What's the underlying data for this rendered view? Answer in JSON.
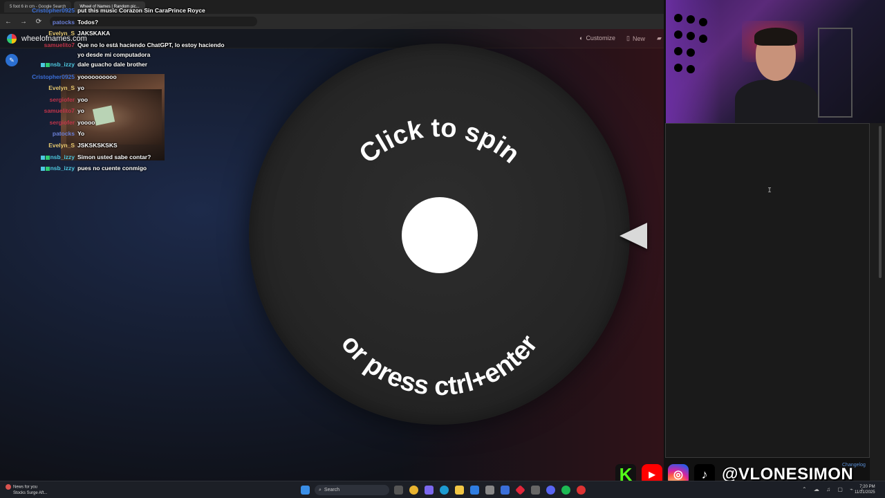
{
  "browser": {
    "tabs": [
      {
        "label": "5 foot 6 in cm - Google Search",
        "active": false
      },
      {
        "label": "Wheel of Names | Random pic...",
        "active": true
      }
    ],
    "nav": {
      "back": "←",
      "forward": "→",
      "reload": "⟳"
    }
  },
  "site": {
    "name": "wheelofnames.com",
    "menu": {
      "customize": "Customize",
      "new": "New"
    },
    "wheel": {
      "top_text": "Click to spin",
      "bottom_text": "or press ctrl+enter"
    }
  },
  "chat": {
    "messages": [
      {
        "user": "Cristopher0925",
        "text": "put this music Corazon Sin CaraPrince Royce",
        "color": "#3b6fd8",
        "badge": false
      },
      {
        "user": "patocks",
        "text": "Todos?",
        "color": "#6a7fd6",
        "badge": false
      },
      {
        "user": "Evelyn_S",
        "text": "JAKSKAKA",
        "color": "#e6c86e",
        "badge": false
      },
      {
        "user": "samuelito7",
        "text": "Que no lo está haciendo ChatGPT, lo estoy haciendo",
        "color": "#c0344a",
        "badge": false
      },
      {
        "user": "",
        "text": "yo desde mi computadora",
        "color": "#c0344a",
        "badge": false
      },
      {
        "user": "nsb_izzy",
        "text": "dale guacho dale brother",
        "color": "#4ec9e0",
        "badge": true
      },
      {
        "user": "Cristopher0925",
        "text": "yoooooooooo",
        "color": "#3b6fd8",
        "badge": false
      },
      {
        "user": "Evelyn_S",
        "text": "yo",
        "color": "#e6c86e",
        "badge": false
      },
      {
        "user": "sergiofer",
        "text": "yoo",
        "color": "#c0344a",
        "badge": false
      },
      {
        "user": "samuelito7",
        "text": "yo",
        "color": "#c0344a",
        "badge": false
      },
      {
        "user": "sergiofer",
        "text": "yoooo",
        "color": "#c0344a",
        "badge": false
      },
      {
        "user": "patocks",
        "text": "Yo",
        "color": "#6a7fd6",
        "badge": false
      },
      {
        "user": "Evelyn_S",
        "text": "JSKSKSKSKS",
        "color": "#e6c86e",
        "badge": false
      },
      {
        "user": "nsb_izzy",
        "text": "Simon usted sabe contar?",
        "color": "#4ec9e0",
        "badge": true
      },
      {
        "user": "nsb_izzy",
        "text": "pues no cuente conmigo",
        "color": "#4ec9e0",
        "badge": true
      }
    ]
  },
  "entries_panel": {
    "changelog": "Changelog"
  },
  "socials": {
    "kick": "K",
    "youtube": "▶",
    "instagram": "◎",
    "tiktok": "♪",
    "handle": "@VLONESIMON"
  },
  "taskbar": {
    "news_title": "News for you",
    "news_sub": "Stocks Surge Aft...",
    "search": "Search",
    "time": "7:20 PM",
    "date": "11/21/2025"
  },
  "colors": {
    "accent": "#2b6fd1",
    "hub": "#ffffff",
    "pointer": "#d9d9d9"
  }
}
